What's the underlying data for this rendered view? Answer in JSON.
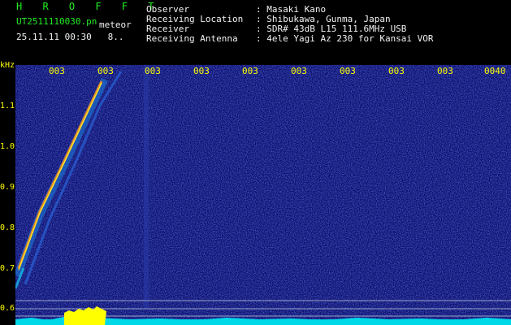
{
  "header": {
    "brand": "H R O F F T",
    "filename": "UT2511110030.pn",
    "tag": "meteor",
    "datetime": "25.11.11 00:30   8..",
    "rows": [
      {
        "label": "Observer",
        "value": ": Masaki Kano"
      },
      {
        "label": "Receiving Location",
        "value": ": Shibukawa, Gunma, Japan"
      },
      {
        "label": "Receiver",
        "value": ": SDR# 43dB L15 111.6MHz USB"
      },
      {
        "label": "Receiving Antenna",
        "value": ": 4ele Yagi Az 230 for Kansai VOR"
      }
    ]
  },
  "axis": {
    "unit": "kHz",
    "y_ticks": [
      "1.1",
      "1.0",
      "0.9",
      "0.8",
      "0.7",
      "0.6"
    ],
    "x_ticks": [
      "003",
      "003",
      "003",
      "003",
      "003",
      "003",
      "003",
      "003",
      "003",
      "0040"
    ]
  },
  "colors": {
    "background": "#0a0c6a",
    "signal": "#ffff00",
    "noise_floor": "#00d0e0",
    "text_header_label": "#f2f2f2",
    "text_brand": "#22ee22"
  }
}
